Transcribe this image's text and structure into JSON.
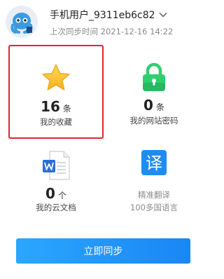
{
  "header": {
    "username": "手机用户_9311eb6c82",
    "sync_time": "上次同步时间 2021-12-16 14:22"
  },
  "tiles": {
    "favorites": {
      "count": "16",
      "unit": "条",
      "label": "我的收藏",
      "icon": "star-icon"
    },
    "passwords": {
      "count": "0",
      "unit": "条",
      "label": "我的网站密码",
      "icon": "lock-icon"
    },
    "docs": {
      "count": "0",
      "unit": "个",
      "label": "我的云文档",
      "icon": "word-doc-icon"
    },
    "translate": {
      "icon_text": "译",
      "line1": "精准翻译",
      "line2": "100多国语言",
      "icon": "translate-icon"
    }
  },
  "sync_button": {
    "label": "立即同步"
  },
  "colors": {
    "accent": "#1a86f5",
    "highlight_border": "#e0262b",
    "star": "#f7c33a",
    "lock": "#2fcf6f",
    "word": "#2b6fd6",
    "translate": "#1f8cf0"
  }
}
